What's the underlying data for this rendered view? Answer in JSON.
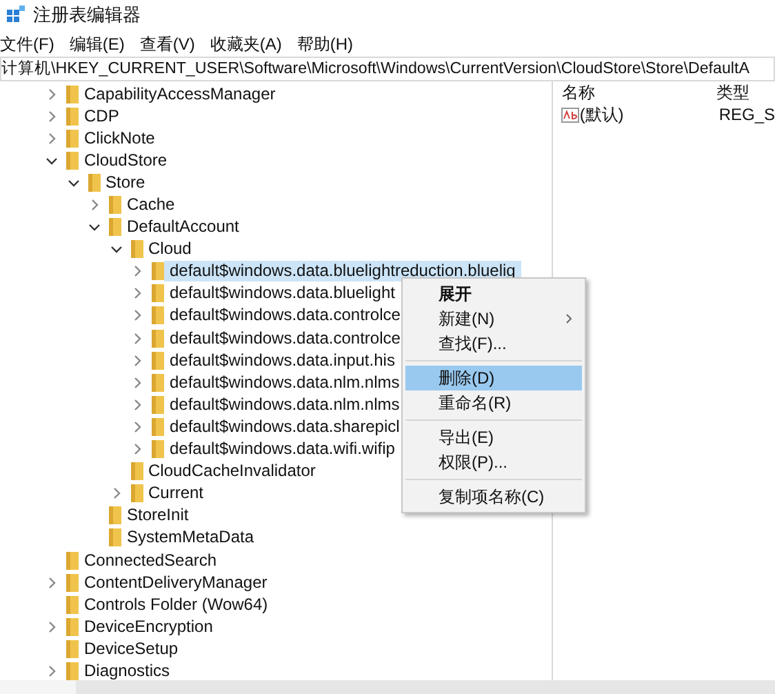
{
  "window": {
    "title": "注册表编辑器"
  },
  "menu_bar": [
    "文件(F)",
    "编辑(E)",
    "查看(V)",
    "收藏夹(A)",
    "帮助(H)"
  ],
  "address_bar": {
    "value": "计算机\\HKEY_CURRENT_USER\\Software\\Microsoft\\Windows\\CurrentVersion\\CloudStore\\Store\\DefaultA"
  },
  "tree": [
    {
      "label": "CapabilityAccessManager",
      "kind": "branch",
      "expanded": false,
      "selected": false
    },
    {
      "label": "CDP",
      "kind": "branch",
      "expanded": false,
      "selected": false
    },
    {
      "label": "ClickNote",
      "kind": "branch",
      "expanded": false,
      "selected": false
    },
    {
      "label": "CloudStore",
      "kind": "branch",
      "expanded": true,
      "selected": false,
      "children": [
        {
          "label": "Store",
          "kind": "branch",
          "expanded": true,
          "selected": false,
          "children": [
            {
              "label": "Cache",
              "kind": "branch",
              "expanded": false,
              "selected": false
            },
            {
              "label": "DefaultAccount",
              "kind": "branch",
              "expanded": true,
              "selected": false,
              "children": [
                {
                  "label": "Cloud",
                  "kind": "branch",
                  "expanded": true,
                  "selected": false,
                  "children": [
                    {
                      "label": "default$windows.data.bluelightreduction.bluelig",
                      "kind": "branch",
                      "expanded": false,
                      "selected": true
                    },
                    {
                      "label": "default$windows.data.bluelight",
                      "kind": "branch",
                      "expanded": false,
                      "selected": false
                    },
                    {
                      "label": "default$windows.data.controlce",
                      "kind": "branch",
                      "expanded": false,
                      "selected": false
                    },
                    {
                      "label": "default$windows.data.controlce",
                      "kind": "branch",
                      "expanded": false,
                      "selected": false
                    },
                    {
                      "label": "default$windows.data.input.his",
                      "kind": "branch",
                      "expanded": false,
                      "selected": false
                    },
                    {
                      "label": "default$windows.data.nlm.nlms",
                      "kind": "branch",
                      "expanded": false,
                      "selected": false
                    },
                    {
                      "label": "default$windows.data.nlm.nlms",
                      "kind": "branch",
                      "expanded": false,
                      "selected": false
                    },
                    {
                      "label": "default$windows.data.sharepicl",
                      "kind": "branch",
                      "expanded": false,
                      "selected": false
                    },
                    {
                      "label": "default$windows.data.wifi.wifip",
                      "kind": "branch",
                      "expanded": false,
                      "selected": false
                    }
                  ]
                },
                {
                  "label": "CloudCacheInvalidator",
                  "kind": "leaf",
                  "selected": false
                },
                {
                  "label": "Current",
                  "kind": "branch",
                  "expanded": false,
                  "selected": false
                }
              ]
            },
            {
              "label": "StoreInit",
              "kind": "leaf",
              "selected": false
            },
            {
              "label": "SystemMetaData",
              "kind": "leaf",
              "selected": false
            }
          ]
        }
      ]
    },
    {
      "label": "ConnectedSearch",
      "kind": "leaf",
      "selected": false
    },
    {
      "label": "ContentDeliveryManager",
      "kind": "branch",
      "expanded": false,
      "selected": false
    },
    {
      "label": "Controls Folder (Wow64)",
      "kind": "leaf",
      "selected": false
    },
    {
      "label": "DeviceEncryption",
      "kind": "branch",
      "expanded": false,
      "selected": false
    },
    {
      "label": "DeviceSetup",
      "kind": "leaf",
      "selected": false
    },
    {
      "label": "Diagnostics",
      "kind": "branch",
      "expanded": false,
      "selected": false
    }
  ],
  "values_pane": {
    "columns": [
      "名称",
      "类型"
    ],
    "rows": [
      {
        "name": "(默认)",
        "type": "REG_S"
      }
    ]
  },
  "context_menu": [
    {
      "kind": "item",
      "label": "展开",
      "default": true,
      "submenu": false,
      "selected": false
    },
    {
      "kind": "item",
      "label": "新建(N)",
      "default": false,
      "submenu": true,
      "selected": false
    },
    {
      "kind": "item",
      "label": "查找(F)...",
      "default": false,
      "submenu": false,
      "selected": false
    },
    {
      "kind": "separator"
    },
    {
      "kind": "item",
      "label": "删除(D)",
      "default": false,
      "submenu": false,
      "selected": true
    },
    {
      "kind": "item",
      "label": "重命名(R)",
      "default": false,
      "submenu": false,
      "selected": false
    },
    {
      "kind": "separator"
    },
    {
      "kind": "item",
      "label": "导出(E)",
      "default": false,
      "submenu": false,
      "selected": false
    },
    {
      "kind": "item",
      "label": "权限(P)...",
      "default": false,
      "submenu": false,
      "selected": false
    },
    {
      "kind": "separator"
    },
    {
      "kind": "item",
      "label": "复制项名称(C)",
      "default": false,
      "submenu": false,
      "selected": false
    }
  ]
}
